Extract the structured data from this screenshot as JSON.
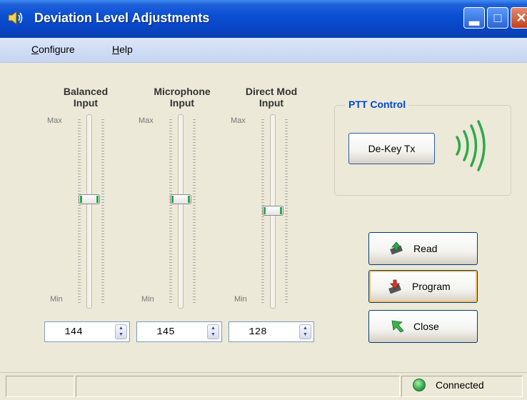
{
  "window": {
    "title": "Deviation Level Adjustments",
    "icon": "speaker-icon"
  },
  "menu": {
    "items": [
      {
        "label": "Configure",
        "mnemonic": "C"
      },
      {
        "label": "Help",
        "mnemonic": "H"
      }
    ]
  },
  "sliders": [
    {
      "title_line1": "Balanced",
      "title_line2": "Input",
      "max_label": "Max",
      "min_label": "Min",
      "value": "144",
      "level": 0.56
    },
    {
      "title_line1": "Microphone",
      "title_line2": "Input",
      "max_label": "Max",
      "min_label": "Min",
      "value": "145",
      "level": 0.56
    },
    {
      "title_line1": "Direct Mod",
      "title_line2": "Input",
      "max_label": "Max",
      "min_label": "Min",
      "value": "128",
      "level": 0.5
    }
  ],
  "ptt": {
    "group_title": "PTT Control",
    "button_label": "De-Key Tx",
    "signal_icon": "radio-waves-icon",
    "signal_color": "#2fa84a"
  },
  "actions": {
    "read_label": "Read",
    "program_label": "Program",
    "close_label": "Close"
  },
  "status": {
    "connection": "Connected",
    "led_color": "#2fa84a"
  }
}
